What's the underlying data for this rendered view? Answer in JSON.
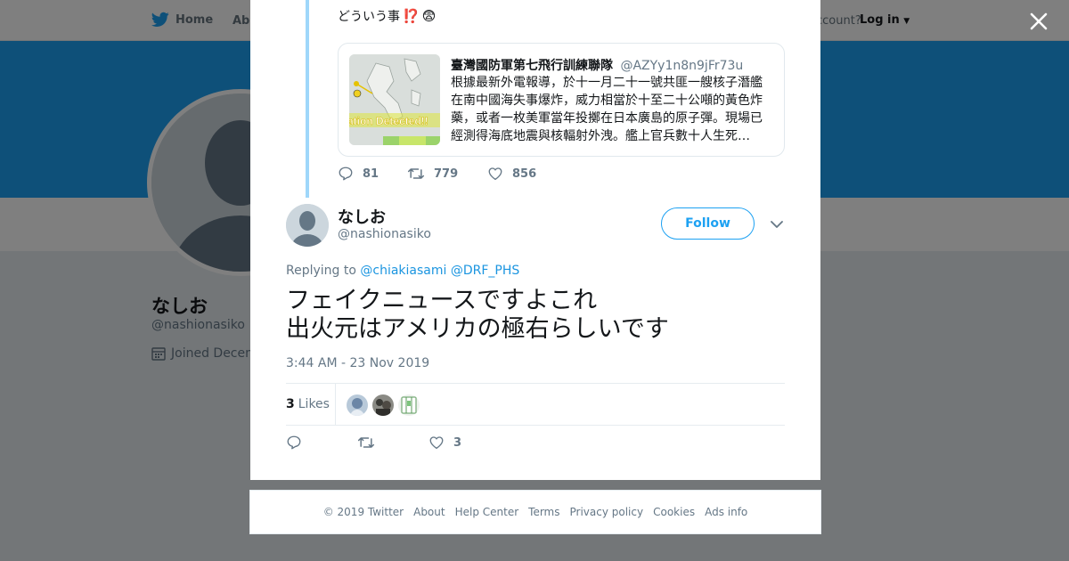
{
  "nav": {
    "home_label": "Home",
    "about_label": "Abo",
    "account_prompt": "ccount?",
    "login_label": "Log in"
  },
  "profile": {
    "name": "なしお",
    "handle": "@nashionasiko",
    "joined": "Joined Decem"
  },
  "previous_tweet": {
    "text": "どういう事",
    "emoji": [
      "⁉️",
      "😨"
    ],
    "quote": {
      "author_name": "臺灣國防軍第七飛行訓練聯隊",
      "author_handle": "@AZYy1n8n9jFr73u",
      "body": "根據最新外電報導，於十一月二十一號共匪一艘核子潛艦在南中國海失事爆炸，威力相當於十至二十公噸的黃色炸藥，或者一枚美軍當年投擲在日本廣島的原子彈。現場已經測得海底地震與核輻射外洩。艦上官兵數十人生死…",
      "thumb_caption": "ation Detected!!"
    },
    "replies": "81",
    "retweets": "779",
    "likes": "856"
  },
  "tweet": {
    "author_name": "なしお",
    "author_handle": "@nashionasiko",
    "follow_label": "Follow",
    "replying_prefix": "Replying to",
    "mentions": [
      "@chiakiasami",
      "@DRF_PHS"
    ],
    "text_lines": [
      "フェイクニュースですよこれ",
      "出火元はアメリカの極右らしいです"
    ],
    "timestamp": "3:44 AM - 23 Nov 2019",
    "likes_count": "3",
    "likes_label": "Likes",
    "action_like_count": "3"
  },
  "footer": {
    "links": [
      "© 2019 Twitter",
      "About",
      "Help Center",
      "Terms",
      "Privacy policy",
      "Cookies",
      "Ads info"
    ]
  },
  "colors": {
    "accent": "#1da1f2",
    "banner": "#1da1f2",
    "thread_line": "#9fd7fa",
    "muted": "#657786"
  }
}
